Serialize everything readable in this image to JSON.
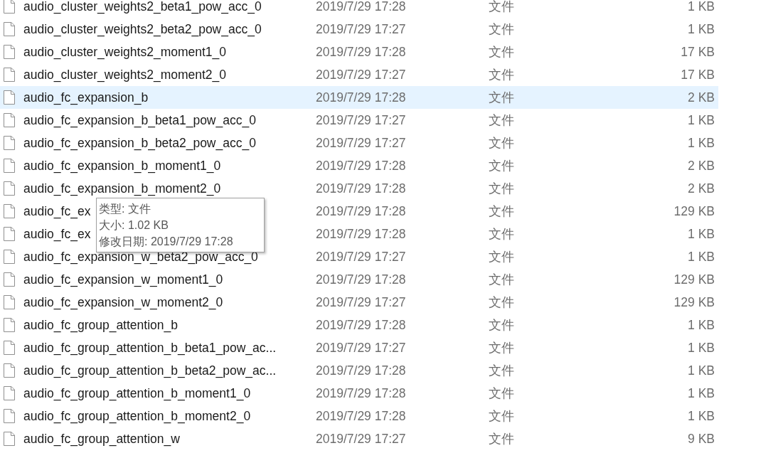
{
  "files": [
    {
      "name": "audio_cluster_weights2_beta1_pow_acc_0",
      "modified": "2019/7/29 17:28",
      "type": "文件",
      "size": "1 KB",
      "selected": false
    },
    {
      "name": "audio_cluster_weights2_beta2_pow_acc_0",
      "modified": "2019/7/29 17:27",
      "type": "文件",
      "size": "1 KB",
      "selected": false
    },
    {
      "name": "audio_cluster_weights2_moment1_0",
      "modified": "2019/7/29 17:28",
      "type": "文件",
      "size": "17 KB",
      "selected": false
    },
    {
      "name": "audio_cluster_weights2_moment2_0",
      "modified": "2019/7/29 17:27",
      "type": "文件",
      "size": "17 KB",
      "selected": false
    },
    {
      "name": "audio_fc_expansion_b",
      "modified": "2019/7/29 17:28",
      "type": "文件",
      "size": "2 KB",
      "selected": true
    },
    {
      "name": "audio_fc_expansion_b_beta1_pow_acc_0",
      "modified": "2019/7/29 17:27",
      "type": "文件",
      "size": "1 KB",
      "selected": false
    },
    {
      "name": "audio_fc_expansion_b_beta2_pow_acc_0",
      "modified": "2019/7/29 17:27",
      "type": "文件",
      "size": "1 KB",
      "selected": false
    },
    {
      "name": "audio_fc_expansion_b_moment1_0",
      "modified": "2019/7/29 17:28",
      "type": "文件",
      "size": "2 KB",
      "selected": false
    },
    {
      "name": "audio_fc_expansion_b_moment2_0",
      "modified": "2019/7/29 17:28",
      "type": "文件",
      "size": "2 KB",
      "selected": false
    },
    {
      "name": "audio_fc_ex",
      "modified": "2019/7/29 17:28",
      "type": "文件",
      "size": "129 KB",
      "selected": false
    },
    {
      "name": "audio_fc_ex",
      "modified": "2019/7/29 17:28",
      "type": "文件",
      "size": "1 KB",
      "selected": false
    },
    {
      "name": "audio_fc_expansion_w_beta2_pow_acc_0",
      "modified": "2019/7/29 17:27",
      "type": "文件",
      "size": "1 KB",
      "selected": false
    },
    {
      "name": "audio_fc_expansion_w_moment1_0",
      "modified": "2019/7/29 17:28",
      "type": "文件",
      "size": "129 KB",
      "selected": false
    },
    {
      "name": "audio_fc_expansion_w_moment2_0",
      "modified": "2019/7/29 17:27",
      "type": "文件",
      "size": "129 KB",
      "selected": false
    },
    {
      "name": "audio_fc_group_attention_b",
      "modified": "2019/7/29 17:28",
      "type": "文件",
      "size": "1 KB",
      "selected": false
    },
    {
      "name": "audio_fc_group_attention_b_beta1_pow_ac...",
      "modified": "2019/7/29 17:27",
      "type": "文件",
      "size": "1 KB",
      "selected": false
    },
    {
      "name": "audio_fc_group_attention_b_beta2_pow_ac...",
      "modified": "2019/7/29 17:28",
      "type": "文件",
      "size": "1 KB",
      "selected": false
    },
    {
      "name": "audio_fc_group_attention_b_moment1_0",
      "modified": "2019/7/29 17:28",
      "type": "文件",
      "size": "1 KB",
      "selected": false
    },
    {
      "name": "audio_fc_group_attention_b_moment2_0",
      "modified": "2019/7/29 17:28",
      "type": "文件",
      "size": "1 KB",
      "selected": false
    },
    {
      "name": "audio_fc_group_attention_w",
      "modified": "2019/7/29 17:27",
      "type": "文件",
      "size": "9 KB",
      "selected": false
    }
  ],
  "tooltip": {
    "lines": [
      "类型: 文件",
      "大小: 1.02 KB",
      "修改日期: 2019/7/29 17:28"
    ]
  }
}
